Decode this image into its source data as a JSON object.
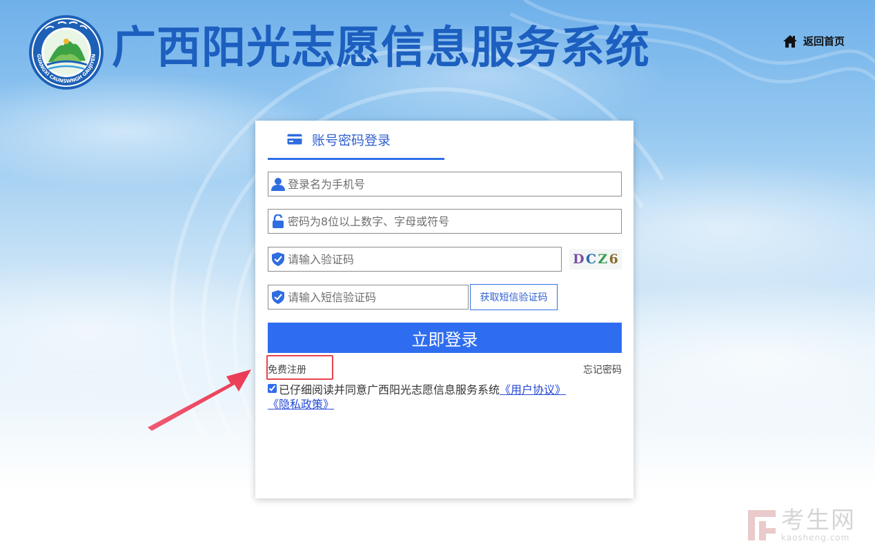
{
  "header": {
    "site_title": "广西阳光志愿信息服务系统",
    "logo_text": "GUANGXI CAUNSWNGH GAUJIYEN",
    "home_label": "返回首页"
  },
  "login": {
    "tab_label": "账号密码登录",
    "username": {
      "placeholder": "登录名为手机号",
      "value": ""
    },
    "password": {
      "placeholder": "密码为8位以上数字、字母或符号",
      "value": ""
    },
    "captcha": {
      "placeholder": "请输入验证码",
      "value": "",
      "image_chars": [
        "D",
        "C",
        "Z",
        "6"
      ]
    },
    "sms_code": {
      "placeholder": "请输入短信验证码",
      "value": ""
    },
    "sms_button": "获取短信验证码",
    "submit_button": "立即登录",
    "register_link": "免费注册",
    "forgot_link": "忘记密码",
    "agreement": {
      "checked": true,
      "text": "已仔细阅读并同意广西阳光志愿信息服务系统",
      "user_agreement": "《用户协议》",
      "privacy_policy": "《隐私政策》"
    }
  },
  "watermark": {
    "cn": "考生网",
    "en": "kaosheng.com"
  },
  "colors": {
    "accent": "#2f6df0",
    "title": "#1c5fbf",
    "highlight": "#e8434b"
  }
}
